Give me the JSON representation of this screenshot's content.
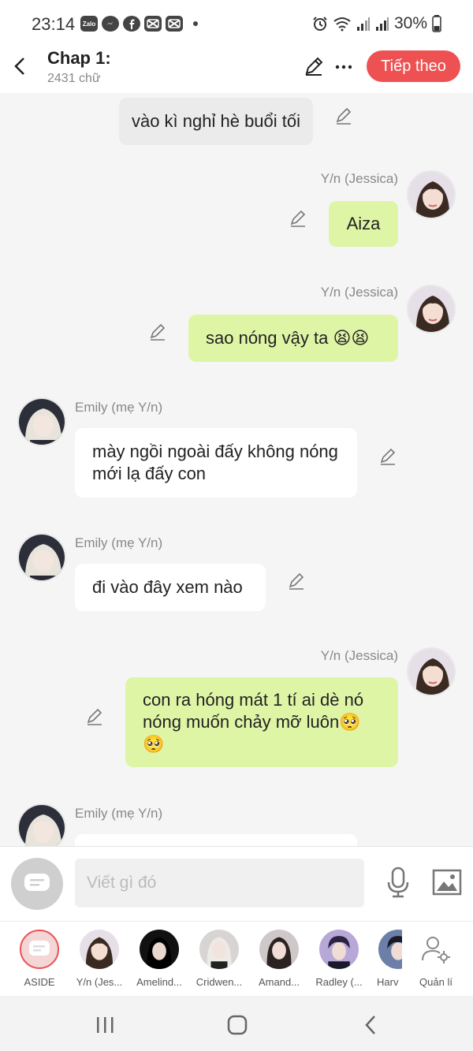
{
  "status_bar": {
    "time": "23:14",
    "apps": [
      "Zalo",
      "messenger-icon",
      "facebook-icon",
      "capcut-icon",
      "capcut-icon"
    ],
    "battery": "30%"
  },
  "header": {
    "title": "Chap 1:",
    "subtitle": "2431 chữ",
    "next_label": "Tiếp theo"
  },
  "messages": [
    {
      "type": "narration",
      "text": "vào kì nghỉ hè buổi tối"
    },
    {
      "type": "right",
      "name": "Y/n (Jessica)",
      "text": "Aiza"
    },
    {
      "type": "right",
      "name": "Y/n (Jessica)",
      "text": "sao nóng vậy ta 😫😫"
    },
    {
      "type": "left",
      "name": "Emily (mẹ Y/n)",
      "text": "mày ngồi ngoài đấy không nóng mới lạ đấy con"
    },
    {
      "type": "left",
      "name": "Emily (mẹ Y/n)",
      "text": "đi vào đây xem nào"
    },
    {
      "type": "right",
      "name": "Y/n (Jessica)",
      "text": "con ra hóng mát 1 tí ai dè nó nóng muốn chảy mỡ luôn🥺🥺"
    },
    {
      "type": "left",
      "name": "Emily (mẹ Y/n)",
      "text": ""
    }
  ],
  "input": {
    "placeholder": "Viết gì đó"
  },
  "characters": [
    {
      "label": "ASIDE"
    },
    {
      "label": "Y/n (Jes..."
    },
    {
      "label": "Amelind..."
    },
    {
      "label": "Cridwen..."
    },
    {
      "label": "Amand..."
    },
    {
      "label": "Radley (..."
    },
    {
      "label": "Harv"
    },
    {
      "label": "Quản lí"
    }
  ],
  "colors": {
    "accent": "#ee5151",
    "right_bubble": "#dff5a6",
    "left_bubble": "#ffffff",
    "narration_bubble": "#ebebeb",
    "background": "#f5f5f5"
  }
}
